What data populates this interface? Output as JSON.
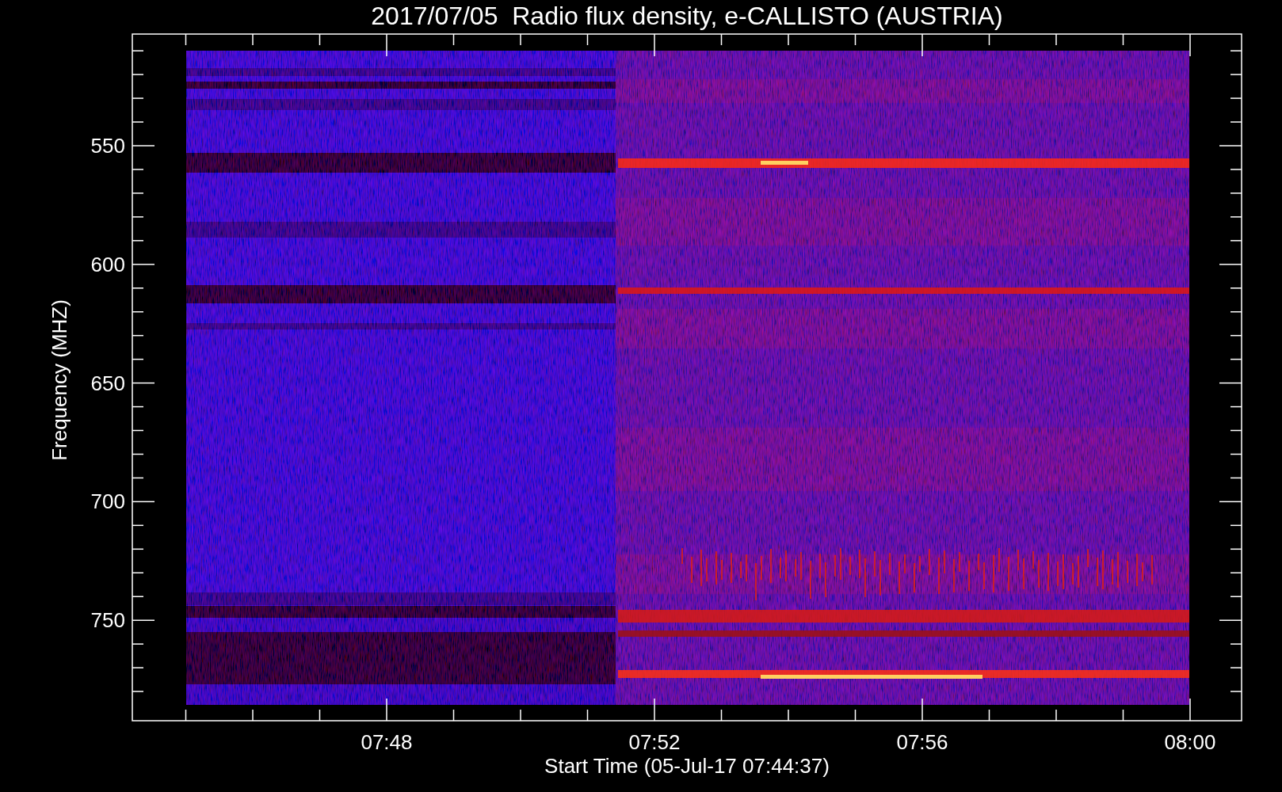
{
  "title": "2017/07/05  Radio flux density, e-CALLISTO (AUSTRIA)",
  "y_axis": {
    "label": "Frequency (MHZ)",
    "ticks": [
      "550",
      "600",
      "650",
      "700",
      "750"
    ]
  },
  "x_axis": {
    "label": "Start Time (05-Jul-17 07:44:37)",
    "ticks": [
      "07:48",
      "07:52",
      "07:56",
      "08:00"
    ]
  }
}
